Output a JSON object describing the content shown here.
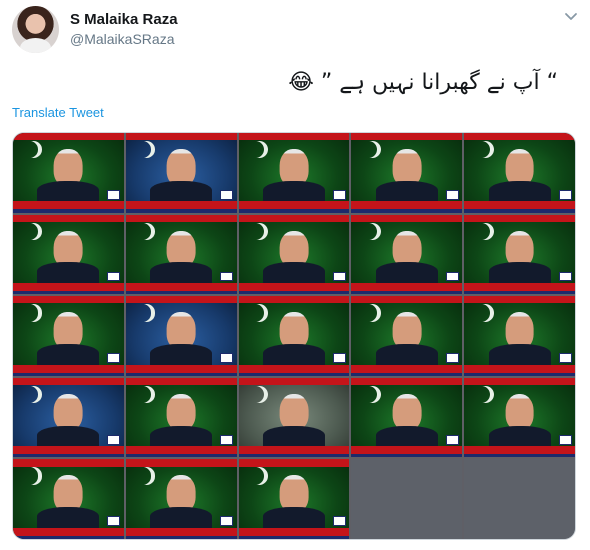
{
  "tweet": {
    "display_name": "S Malaika Raza",
    "handle": "@MalaikaSRaza",
    "text": "“ آپ نے گھبرانا نہیں ہے ” 😂",
    "translate_label": "Translate Tweet"
  },
  "media": {
    "tiles": [
      {
        "style": "green",
        "logo": true
      },
      {
        "style": "blue",
        "logo": true
      },
      {
        "style": "green",
        "logo": true
      },
      {
        "style": "green",
        "logo": true
      },
      {
        "style": "green",
        "logo": true
      },
      {
        "style": "green",
        "logo": true
      },
      {
        "style": "green",
        "logo": true
      },
      {
        "style": "green",
        "logo": true
      },
      {
        "style": "green",
        "logo": true
      },
      {
        "style": "green",
        "logo": true
      },
      {
        "style": "green",
        "logo": true
      },
      {
        "style": "blue",
        "logo": true
      },
      {
        "style": "green",
        "logo": true
      },
      {
        "style": "green",
        "logo": true
      },
      {
        "style": "green",
        "logo": true
      },
      {
        "style": "blue",
        "logo": true
      },
      {
        "style": "green",
        "logo": true
      },
      {
        "style": "grey",
        "logo": false
      },
      {
        "style": "green",
        "logo": true
      },
      {
        "style": "green",
        "logo": true
      },
      {
        "style": "green",
        "logo": true
      },
      {
        "style": "green",
        "logo": true
      },
      {
        "style": "green",
        "logo": true
      },
      {
        "style": "empty",
        "logo": false
      },
      {
        "style": "empty",
        "logo": false
      }
    ]
  },
  "icons": {
    "menu": "chevron-down-icon"
  }
}
